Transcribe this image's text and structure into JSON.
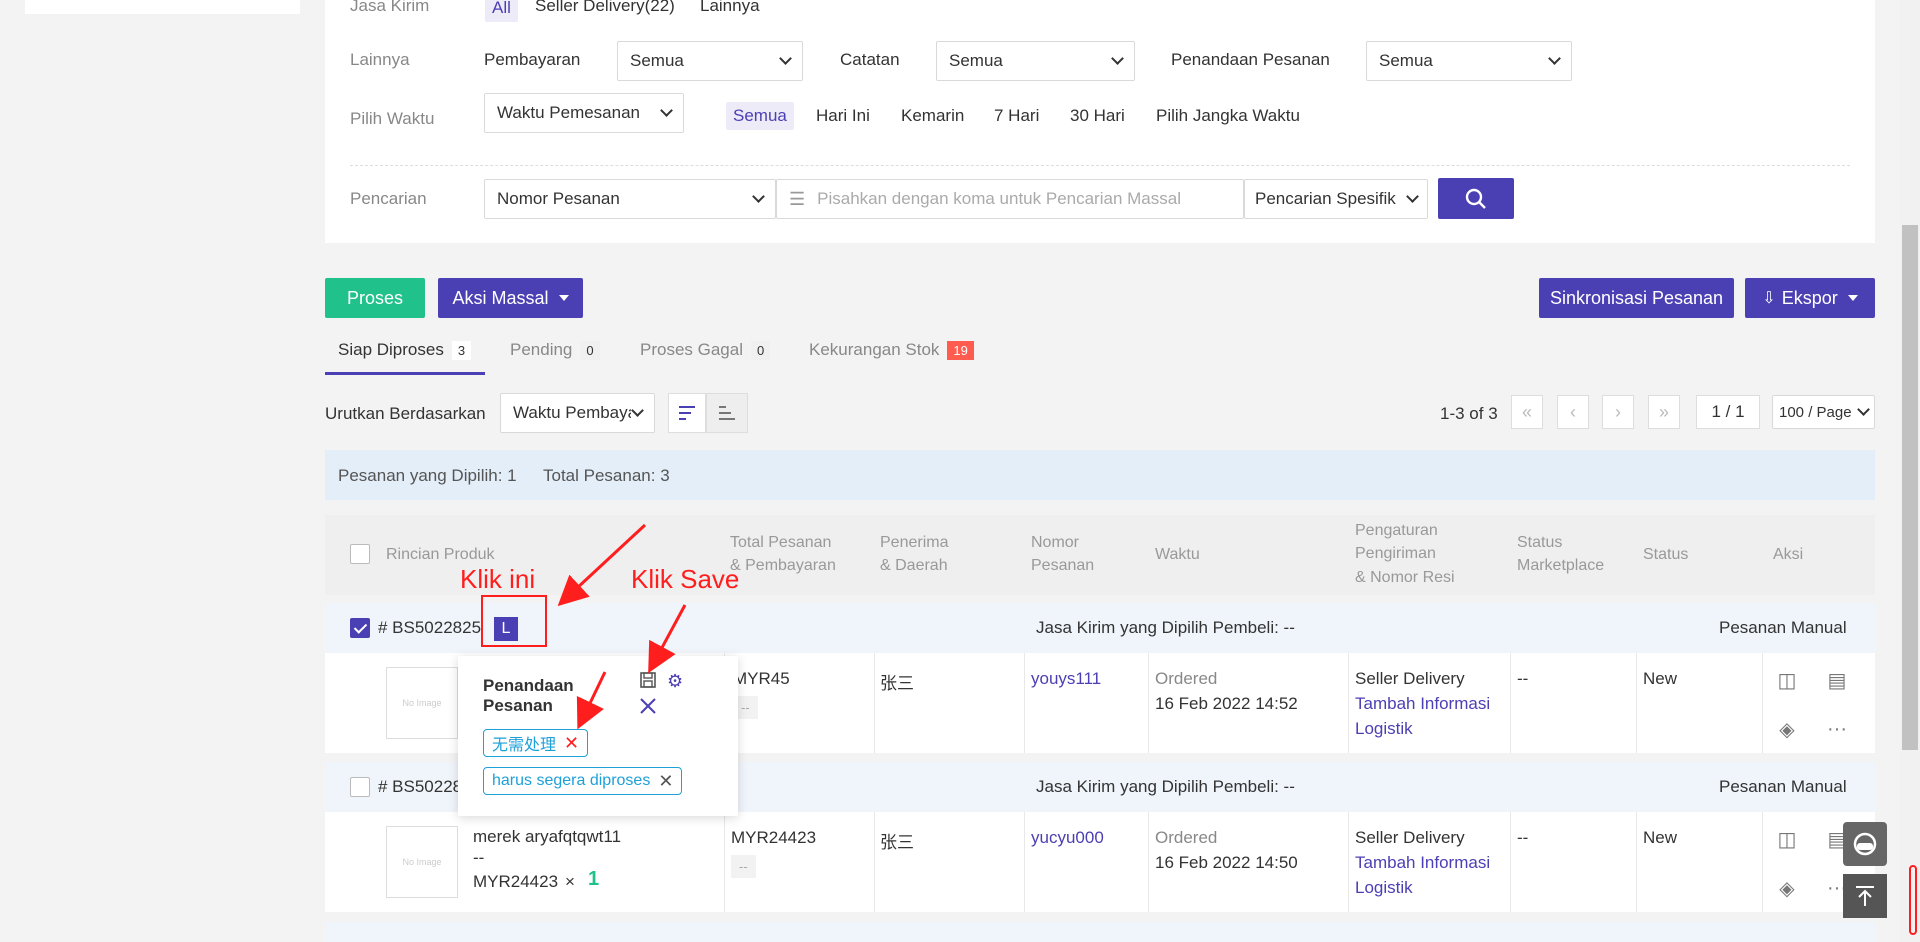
{
  "filters": {
    "jasa_kirim_label": "Jasa Kirim",
    "jasa_kirim_options": [
      "All",
      "Seller Delivery(22)",
      "Lainnya"
    ],
    "lainnya_label": "Lainnya",
    "pembayaran_label": "Pembayaran",
    "pembayaran_value": "Semua",
    "catatan_label": "Catatan",
    "catatan_value": "Semua",
    "penandaan_label": "Penandaan Pesanan",
    "penandaan_value": "Semua",
    "pilih_waktu_label": "Pilih Waktu",
    "waktu_select_value": "Waktu Pemesanan",
    "waktu_options": [
      "Semua",
      "Hari Ini",
      "Kemarin",
      "7 Hari",
      "30 Hari",
      "Pilih Jangka Waktu"
    ],
    "pencarian_label": "Pencarian",
    "pencarian_type": "Nomor Pesanan",
    "pencarian_placeholder": "Pisahkan dengan koma untuk Pencarian Massal",
    "pencarian_mode": "Pencarian Spesifik"
  },
  "toolbar": {
    "proses": "Proses",
    "aksi_massal": "Aksi Massal",
    "sinkronisasi": "Sinkronisasi Pesanan",
    "ekspor": "Ekspor"
  },
  "tabs": [
    {
      "label": "Siap Diproses",
      "count": "3"
    },
    {
      "label": "Pending",
      "count": "0"
    },
    {
      "label": "Proses Gagal",
      "count": "0"
    },
    {
      "label": "Kekurangan Stok",
      "count": "19"
    }
  ],
  "sort": {
    "label": "Urutkan Berdasarkan",
    "value": "Waktu Pembayaran"
  },
  "pager": {
    "range": "1-3 of 3",
    "page": "1 / 1",
    "per_page": "100 / Page"
  },
  "info": {
    "selected": "Pesanan yang Dipilih: 1",
    "total": "Total Pesanan: 3"
  },
  "headers": {
    "produk": "Rincian Produk",
    "total_1": "Total Pesanan",
    "total_2": "& Pembayaran",
    "penerima_1": "Penerima",
    "penerima_2": "& Daerah",
    "nomor_1": "Nomor",
    "nomor_2": "Pesanan",
    "waktu": "Waktu",
    "pengaturan_1": "Pengaturan",
    "pengaturan_2": "Pengiriman",
    "pengaturan_3": "& Nomor Resi",
    "status_mp_1": "Status",
    "status_mp_2": "Marketplace",
    "status": "Status",
    "aksi": "Aksi"
  },
  "orders": [
    {
      "id": "# BS5022825",
      "tag": "L",
      "jasa": "Jasa Kirim yang Dipilih Pembeli: --",
      "type": "Pesanan Manual",
      "total": "MYR45",
      "pay": "--",
      "penerima": "张三",
      "buyer": "youys111",
      "ordered": "Ordered",
      "date": "16 Feb 2022 14:52",
      "delivery": "Seller Delivery",
      "logistik_1": "Tambah Informasi",
      "logistik_2": "Logistik",
      "status_mp": "--",
      "status": "New"
    },
    {
      "id": "# BS50228",
      "jasa": "Jasa Kirim yang Dipilih Pembeli: --",
      "type": "Pesanan Manual",
      "product": "merek aryafqtqwt11",
      "variant": "--",
      "price": "MYR24423",
      "qty_x": "×",
      "qty": "1",
      "total": "MYR24423",
      "pay": "--",
      "penerima": "张三",
      "buyer": "yucyu000",
      "ordered": "Ordered",
      "date": "16 Feb 2022 14:50",
      "delivery": "Seller Delivery",
      "logistik_1": "Tambah Informasi",
      "logistik_2": "Logistik",
      "status_mp": "--",
      "status": "New"
    }
  ],
  "popup": {
    "title_1": "Penandaan",
    "title_2": "Pesanan",
    "tags": [
      "无需处理",
      "harus segera diproses"
    ]
  },
  "annotations": {
    "klik_ini": "Klik ini",
    "klik_save": "Klik Save"
  },
  "colors": {
    "accent": "#4b3fb4",
    "green": "#20c18b",
    "annotation": "#ff1e1e",
    "tag": "#1ea0d8"
  }
}
